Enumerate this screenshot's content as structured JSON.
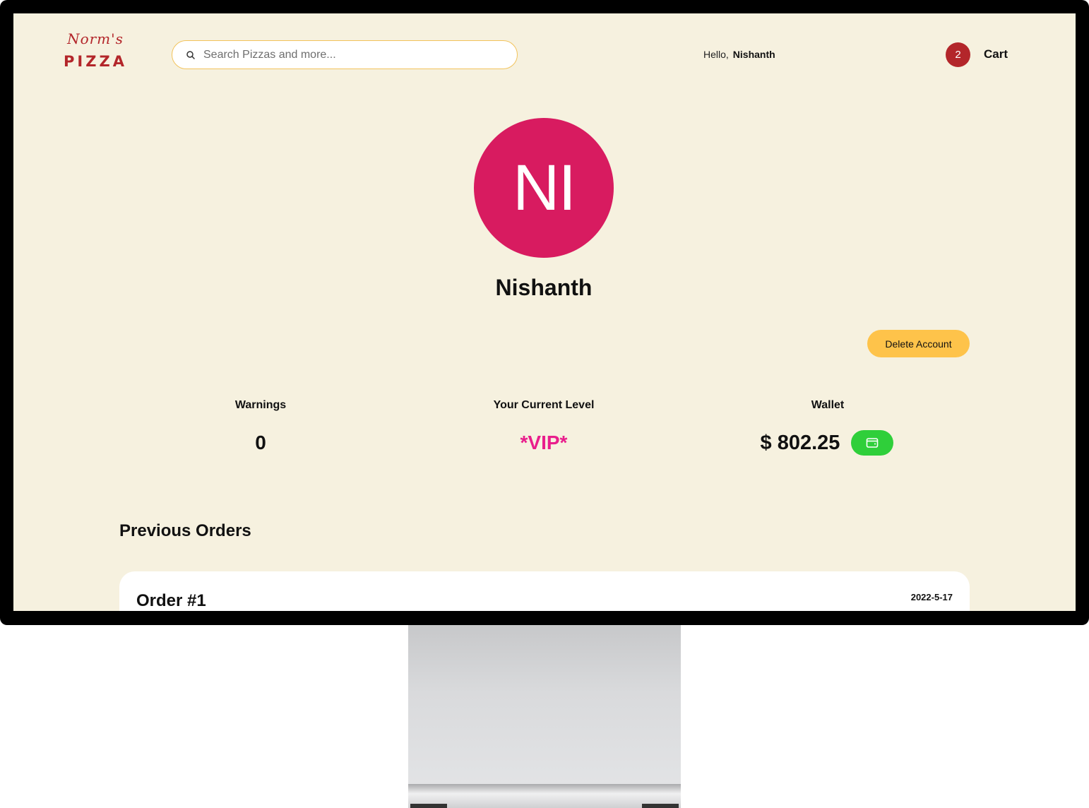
{
  "header": {
    "logo_script": "Norm's",
    "logo_main": "PIZZA",
    "search_placeholder": "Search Pizzas and more...",
    "greeting_prefix": "Hello,",
    "greeting_name": "Nishanth",
    "cart_count": "2",
    "cart_label": "Cart"
  },
  "profile": {
    "initials": "NI",
    "name": "Nishanth",
    "avatar_color": "#d81b60",
    "delete_label": "Delete Account"
  },
  "stats": {
    "warnings_label": "Warnings",
    "warnings_value": "0",
    "level_label": "Your Current Level",
    "level_value": "*VIP*",
    "wallet_label": "Wallet",
    "wallet_value": "$ 802.25"
  },
  "orders": {
    "section_title": "Previous Orders",
    "items": [
      {
        "title": "Order #1",
        "date": "2022-5-17"
      }
    ]
  },
  "colors": {
    "background": "#f6f1df",
    "brand_red": "#b3262a",
    "accent_yellow": "#fec34a",
    "vip_pink": "#e91e8c",
    "wallet_green": "#2fcf3a"
  }
}
